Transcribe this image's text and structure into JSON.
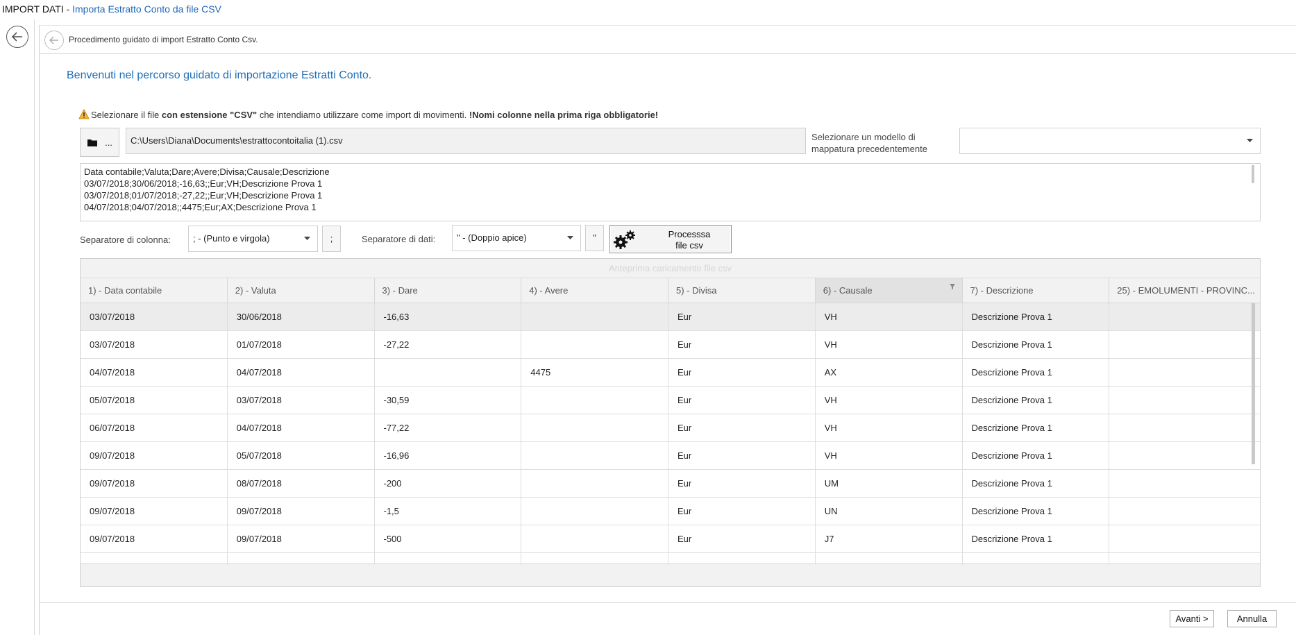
{
  "window": {
    "title_prefix": "IMPORT DATI - ",
    "title_sub": "Importa Estratto Conto da file CSV"
  },
  "panel": {
    "subtitle": "Procedimento guidato di import Estratto Conto Csv."
  },
  "welcome": "Benvenuti nel percorso guidato di importazione Estratti Conto.",
  "warning": {
    "part1": "Selezionare il file ",
    "bold1": "con estensione \"CSV\"",
    "part2": " che intendiamo utilizzare come import di movimenti. ",
    "bold2": "!Nomi colonne nella prima riga obbligatorie!"
  },
  "file": {
    "browse_label": "...",
    "path": "C:\\Users\\Diana\\Documents\\estrattocontoitalia (1).csv"
  },
  "model": {
    "label_line1": "Selezionare un modello di",
    "label_line2": "mappatura precedentemente",
    "value": ""
  },
  "preview_lines": [
    "Data contabile;Valuta;Dare;Avere;Divisa;Causale;Descrizione",
    "03/07/2018;30/06/2018;-16,63;;Eur;VH;Descrizione Prova 1",
    "03/07/2018;01/07/2018;-27,22;;Eur;VH;Descrizione Prova 1",
    "04/07/2018;04/07/2018;;4475;Eur;AX;Descrizione Prova 1"
  ],
  "separators": {
    "column_label": "Separatore di colonna:",
    "column_value": "; - (Punto e virgola)",
    "column_char": ";",
    "data_label": "Separatore di dati:",
    "data_value": "\" - (Doppio apice)",
    "data_char": "\""
  },
  "process_button": {
    "line1": "Processsa",
    "line2": "file csv"
  },
  "grid": {
    "caption": "Anteprima caricamento file csv",
    "columns": [
      "1) - Data contabile",
      "2) - Valuta",
      "3) - Dare",
      "4) - Avere",
      "5) - Divisa",
      "6) - Causale",
      "7) - Descrizione",
      "25) - EMOLUMENTI -  PROVINC..."
    ],
    "rows": [
      [
        "03/07/2018",
        "30/06/2018",
        "-16,63",
        "",
        "Eur",
        "VH",
        "Descrizione Prova 1",
        ""
      ],
      [
        "03/07/2018",
        "01/07/2018",
        "-27,22",
        "",
        "Eur",
        "VH",
        "Descrizione Prova 1",
        ""
      ],
      [
        "04/07/2018",
        "04/07/2018",
        "",
        "4475",
        "Eur",
        "AX",
        "Descrizione Prova 1",
        ""
      ],
      [
        "05/07/2018",
        "03/07/2018",
        "-30,59",
        "",
        "Eur",
        "VH",
        "Descrizione Prova 1",
        ""
      ],
      [
        "06/07/2018",
        "04/07/2018",
        "-77,22",
        "",
        "Eur",
        "VH",
        "Descrizione Prova 1",
        ""
      ],
      [
        "09/07/2018",
        "05/07/2018",
        "-16,96",
        "",
        "Eur",
        "VH",
        "Descrizione Prova 1",
        ""
      ],
      [
        "09/07/2018",
        "08/07/2018",
        "-200",
        "",
        "Eur",
        "UM",
        "Descrizione Prova 1",
        ""
      ],
      [
        "09/07/2018",
        "09/07/2018",
        "-1,5",
        "",
        "Eur",
        "UN",
        "Descrizione Prova 1",
        ""
      ],
      [
        "09/07/2018",
        "09/07/2018",
        "-500",
        "",
        "Eur",
        "J7",
        "Descrizione Prova 1",
        ""
      ],
      [
        "",
        "",
        "",
        "",
        "",
        "",
        "",
        ""
      ]
    ]
  },
  "footer": {
    "next_label": "Avanti >",
    "cancel_label": "Annulla"
  }
}
